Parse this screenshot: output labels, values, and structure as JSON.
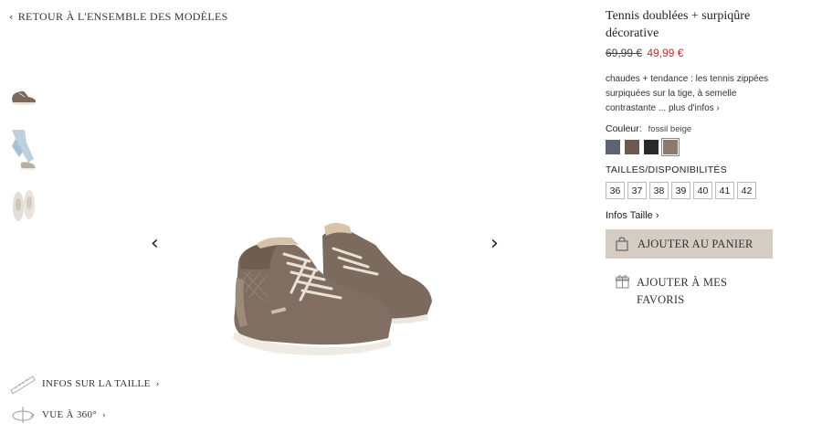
{
  "nav": {
    "back_label": "RETOUR À L'ENSEMBLE DES MODÈLES"
  },
  "gallery": {
    "thumbnails": [
      "shoe-side-thumb",
      "worn-leg-thumb",
      "shoe-top-thumb"
    ],
    "prev_icon": "chevron-left-icon",
    "next_icon": "chevron-right-icon"
  },
  "links": {
    "size_info": "INFOS SUR LA TAILLE",
    "view_360": "VUE À 360°"
  },
  "product": {
    "title": "Tennis doublées + surpiqûre décorative",
    "old_price": "69,99 €",
    "new_price": "49,99 €",
    "description": "chaudes + tendance : les tennis zippées surpiquées sur la tige, à semelle contrastante ... ",
    "more_link": "plus d'infos ›",
    "color_label": "Couleur:",
    "color_value": "fossil beige",
    "swatches": [
      "#5d6470",
      "#6d5a4e",
      "#2a2a2a",
      "#8b7b6b"
    ],
    "sizes_header": "TAILLES/DISPONIBILITÉS",
    "sizes": [
      "36",
      "37",
      "38",
      "39",
      "40",
      "41",
      "42"
    ],
    "infos_taille": "Infos Taille ›",
    "add_to_cart": "AJOUTER AU PANIER",
    "add_to_favorites": "AJOUTER À MES FAVORIS"
  },
  "colors": {
    "sale_price": "#b5352e",
    "cart_button": "#d5ccc4"
  }
}
